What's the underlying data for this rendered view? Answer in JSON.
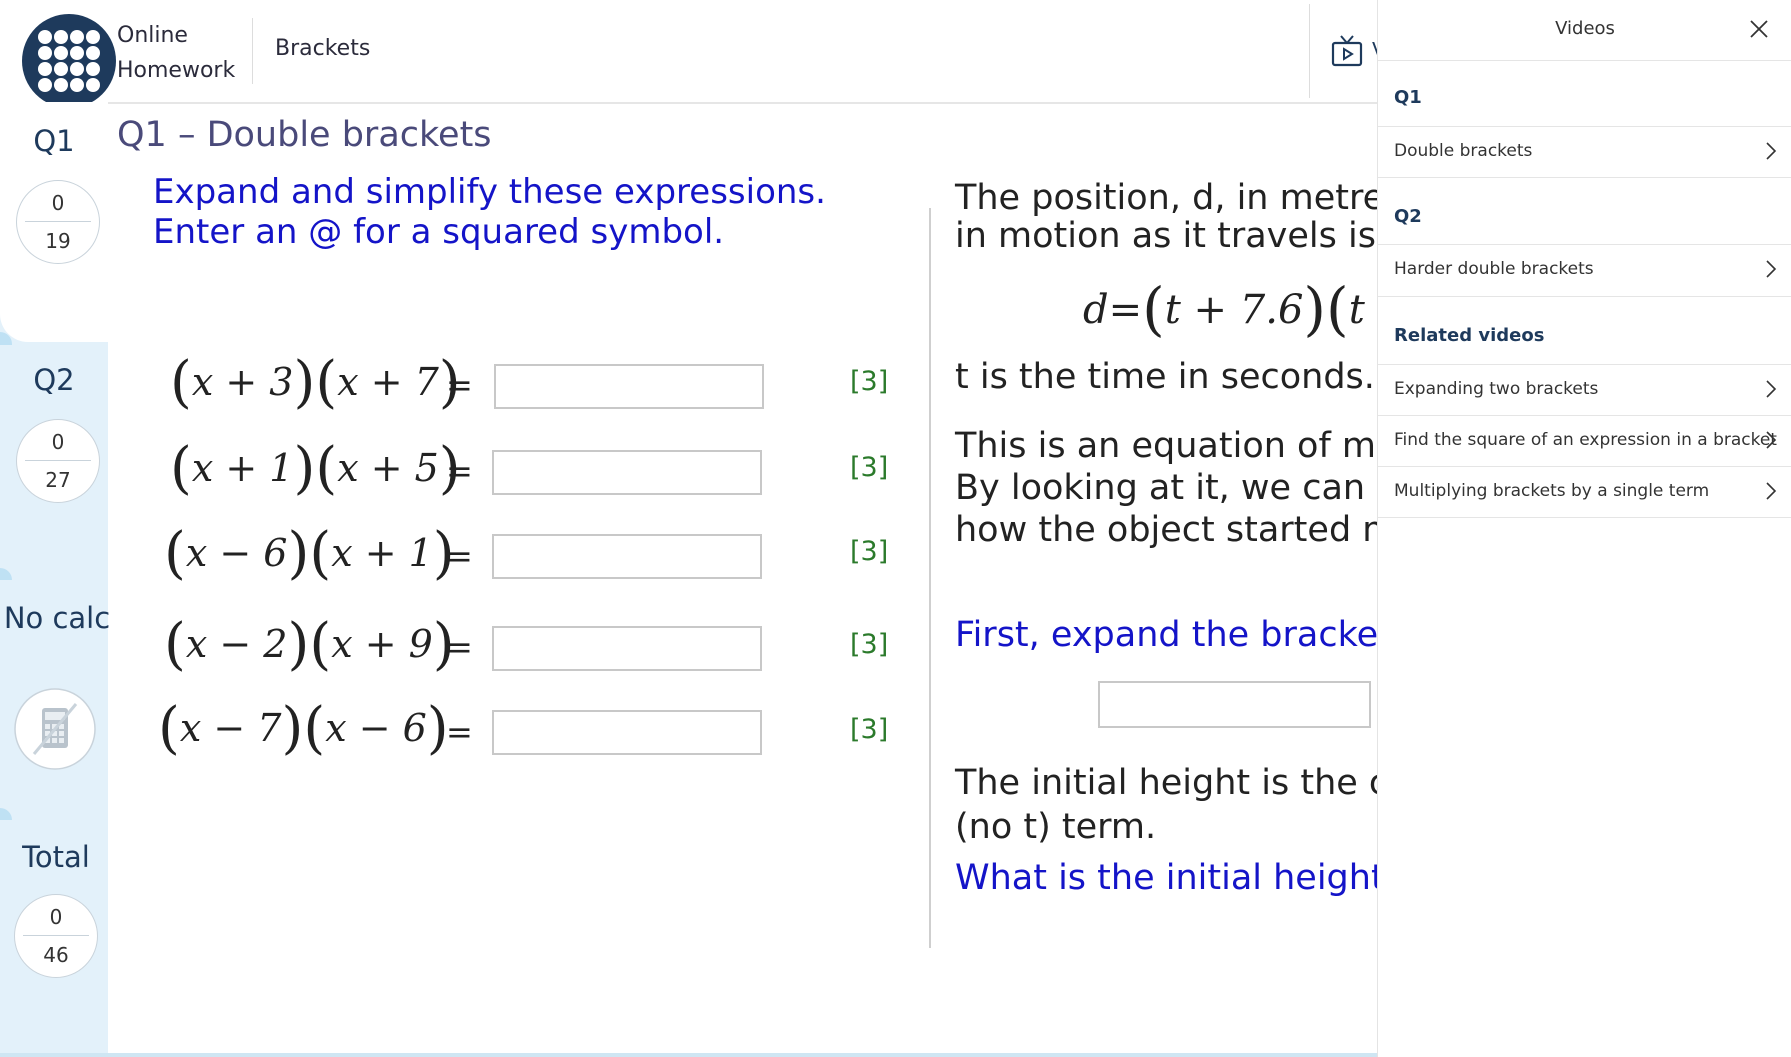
{
  "header": {
    "app_title": "Online Homework",
    "topic": "Brackets",
    "videos_button_label": "V"
  },
  "rail": {
    "tabs": [
      {
        "label": "Q1",
        "score": "0",
        "max": "19",
        "active": true
      },
      {
        "label": "Q2",
        "score": "0",
        "max": "27",
        "active": false
      },
      {
        "label": "No calc",
        "icon": "no-calculator-icon"
      },
      {
        "label": "Total",
        "score": "0",
        "max": "46"
      }
    ]
  },
  "q1": {
    "title": "Q1 – Double brackets",
    "instructions": "Expand and simplify these expressions.\nEnter an @ for a squared symbol.",
    "rows": [
      {
        "a": "x + 3",
        "b": "x + 7",
        "marks": "[3]"
      },
      {
        "a": "x + 1",
        "b": "x + 5",
        "marks": "[3]"
      },
      {
        "a": "x − 6",
        "b": "x + 1",
        "marks": "[3]"
      },
      {
        "a": "x − 2",
        "b": "x + 9",
        "marks": "[3]"
      },
      {
        "a": "x − 7",
        "b": "x − 6",
        "marks": "[3]"
      }
    ],
    "equals": "="
  },
  "q2": {
    "line1": "The position, d, in metre",
    "line2": "in motion as it travels is",
    "formula_d": "d",
    "formula_eq": "=",
    "formula_a": "t + 7.6",
    "formula_b": "t +",
    "time_line": "t is the time in seconds.",
    "para1": "This is an equation of mo",
    "para2": "By looking at it, we can l",
    "para3": "how the object started m",
    "expand_prompt": "First, expand the bracket",
    "initial1": "The initial height is the c",
    "initial2": "(no t) term.",
    "initial_question": "What is the initial height"
  },
  "videos_panel": {
    "title": "Videos",
    "sections": [
      {
        "heading": "Q1",
        "items": [
          "Double brackets"
        ]
      },
      {
        "heading": "Q2",
        "items": [
          "Harder double brackets"
        ]
      },
      {
        "heading": "Related videos",
        "items": [
          "Expanding two brackets",
          "Find the square of an expression in a bracket",
          "Multiplying brackets by a single term"
        ]
      }
    ]
  }
}
